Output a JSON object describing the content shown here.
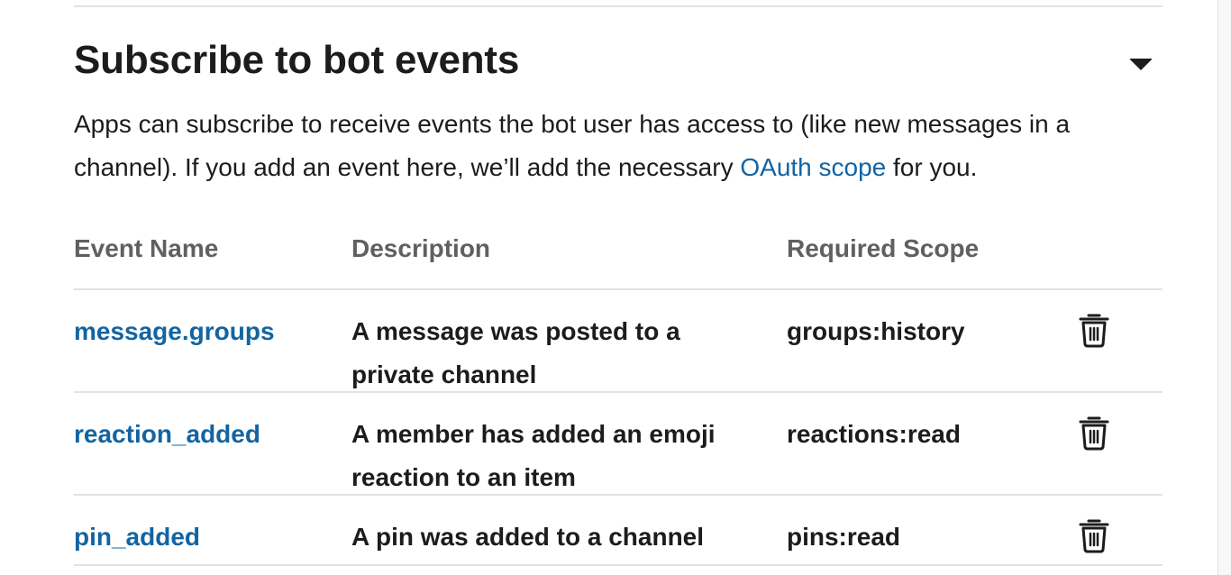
{
  "section": {
    "title": "Subscribe to bot events",
    "description_before": "Apps can subscribe to receive events the bot user has access to (like new messages in a channel). If you add an event here, we’ll add the necessary ",
    "link_text": "OAuth scope",
    "description_after": " for you.",
    "collapse_icon": "caret-down-icon"
  },
  "table": {
    "headers": {
      "event_name": "Event Name",
      "description": "Description",
      "required_scope": "Required Scope"
    },
    "rows": [
      {
        "event_name": "message.groups",
        "description": "A message was posted to a private channel",
        "scope": "groups:history",
        "action_icon": "trash-icon"
      },
      {
        "event_name": "reaction_added",
        "description": "A member has added an emoji reaction to an item",
        "scope": "reactions:read",
        "action_icon": "trash-icon"
      },
      {
        "event_name": "pin_added",
        "description": "A pin was added to a channel",
        "scope": "pins:read",
        "action_icon": "trash-icon"
      }
    ]
  },
  "colors": {
    "link": "#1264a3",
    "text": "#1d1c1d",
    "muted": "#616061",
    "divider": "#e2e2e2"
  }
}
